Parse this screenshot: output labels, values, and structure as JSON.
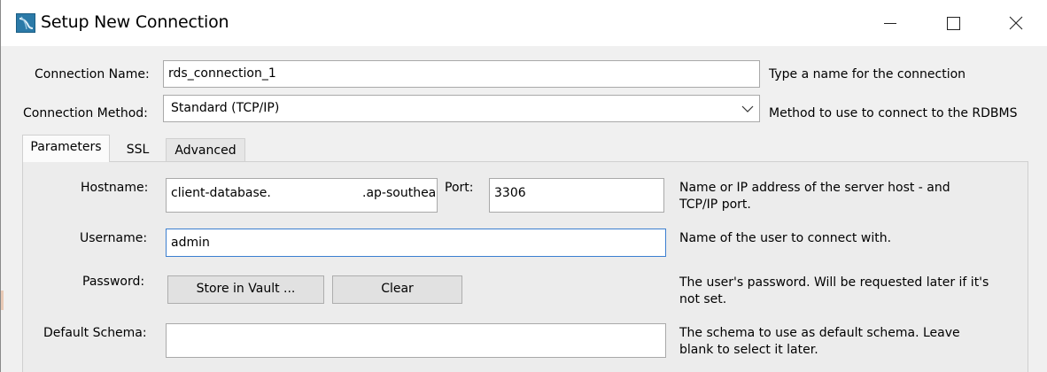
{
  "window": {
    "title": "Setup New Connection",
    "controls": [
      "minimize-icon",
      "maximize-icon",
      "close-icon"
    ]
  },
  "connection_name": {
    "label": "Connection Name:",
    "value": "rds_connection_1",
    "hint": "Type a name for the connection"
  },
  "connection_method": {
    "label": "Connection Method:",
    "value": "Standard (TCP/IP)",
    "hint": "Method to use to connect to the RDBMS"
  },
  "tabs": [
    {
      "label": "Parameters",
      "active": true
    },
    {
      "label": "SSL",
      "active": false
    },
    {
      "label": "Advanced",
      "active": false
    }
  ],
  "parameters": {
    "hostname": {
      "label": "Hostname:",
      "value_prefix": "client-database.",
      "value_suffix": ".ap-southea",
      "hint_line1": "Name or IP address of the server host - and",
      "hint_line2": "TCP/IP port."
    },
    "port": {
      "label": "Port:",
      "value": "3306"
    },
    "username": {
      "label": "Username:",
      "value": "admin",
      "hint": "Name of the user to connect with."
    },
    "password": {
      "label": "Password:",
      "store_button": "Store in Vault ...",
      "clear_button": "Clear",
      "hint_line1": "The user's password. Will be requested later if it's",
      "hint_line2": "not set."
    },
    "default_schema": {
      "label": "Default Schema:",
      "value": "",
      "hint_line1": "The schema to use as default schema. Leave",
      "hint_line2": "blank to select it later."
    }
  }
}
